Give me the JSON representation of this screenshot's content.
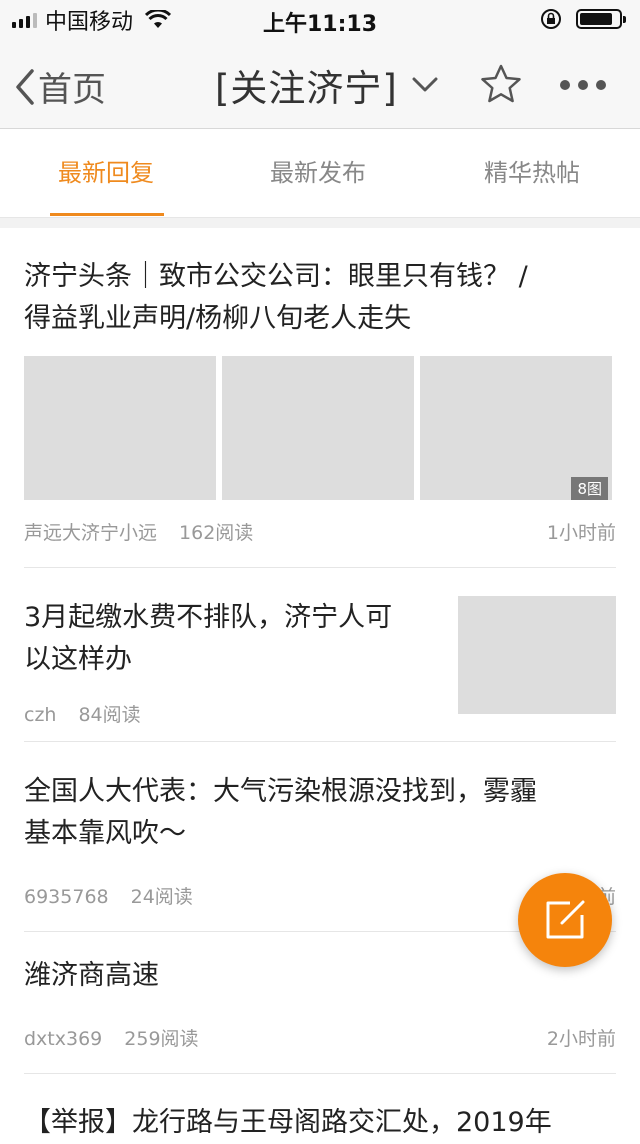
{
  "status_bar": {
    "carrier": "中国移动",
    "time": "上午11:13"
  },
  "nav": {
    "back_label": "首页",
    "title": "[关注济宁]"
  },
  "tabs": [
    {
      "label": "最新回复",
      "active": true
    },
    {
      "label": "最新发布",
      "active": false
    },
    {
      "label": "精华热帖",
      "active": false
    }
  ],
  "accent_color": "#ef8a1e",
  "posts": [
    {
      "title_line1": "济宁头条｜致市公交公司：眼里只有钱？ /",
      "title_line2": "得益乳业声明/杨柳八旬老人走失",
      "author": "声远大济宁小远",
      "reads": "162阅读",
      "time": "1小时前",
      "image_count": "8图"
    },
    {
      "title_line1": "3月起缴水费不排队，济宁人可",
      "title_line2": "以这样办",
      "author": "czh",
      "reads": "84阅读"
    },
    {
      "title_line1": "全国人大代表：大气污染根源没找到，雾霾",
      "title_line2": "基本靠风吹～",
      "author": "6935768",
      "reads": "24阅读",
      "time_partial": "前"
    },
    {
      "title_line1": "潍济商高速",
      "author": "dxtx369",
      "reads": "259阅读",
      "time": "2小时前"
    },
    {
      "title_line1": "【举报】龙行路与王母阁路交汇处，2019年"
    }
  ]
}
